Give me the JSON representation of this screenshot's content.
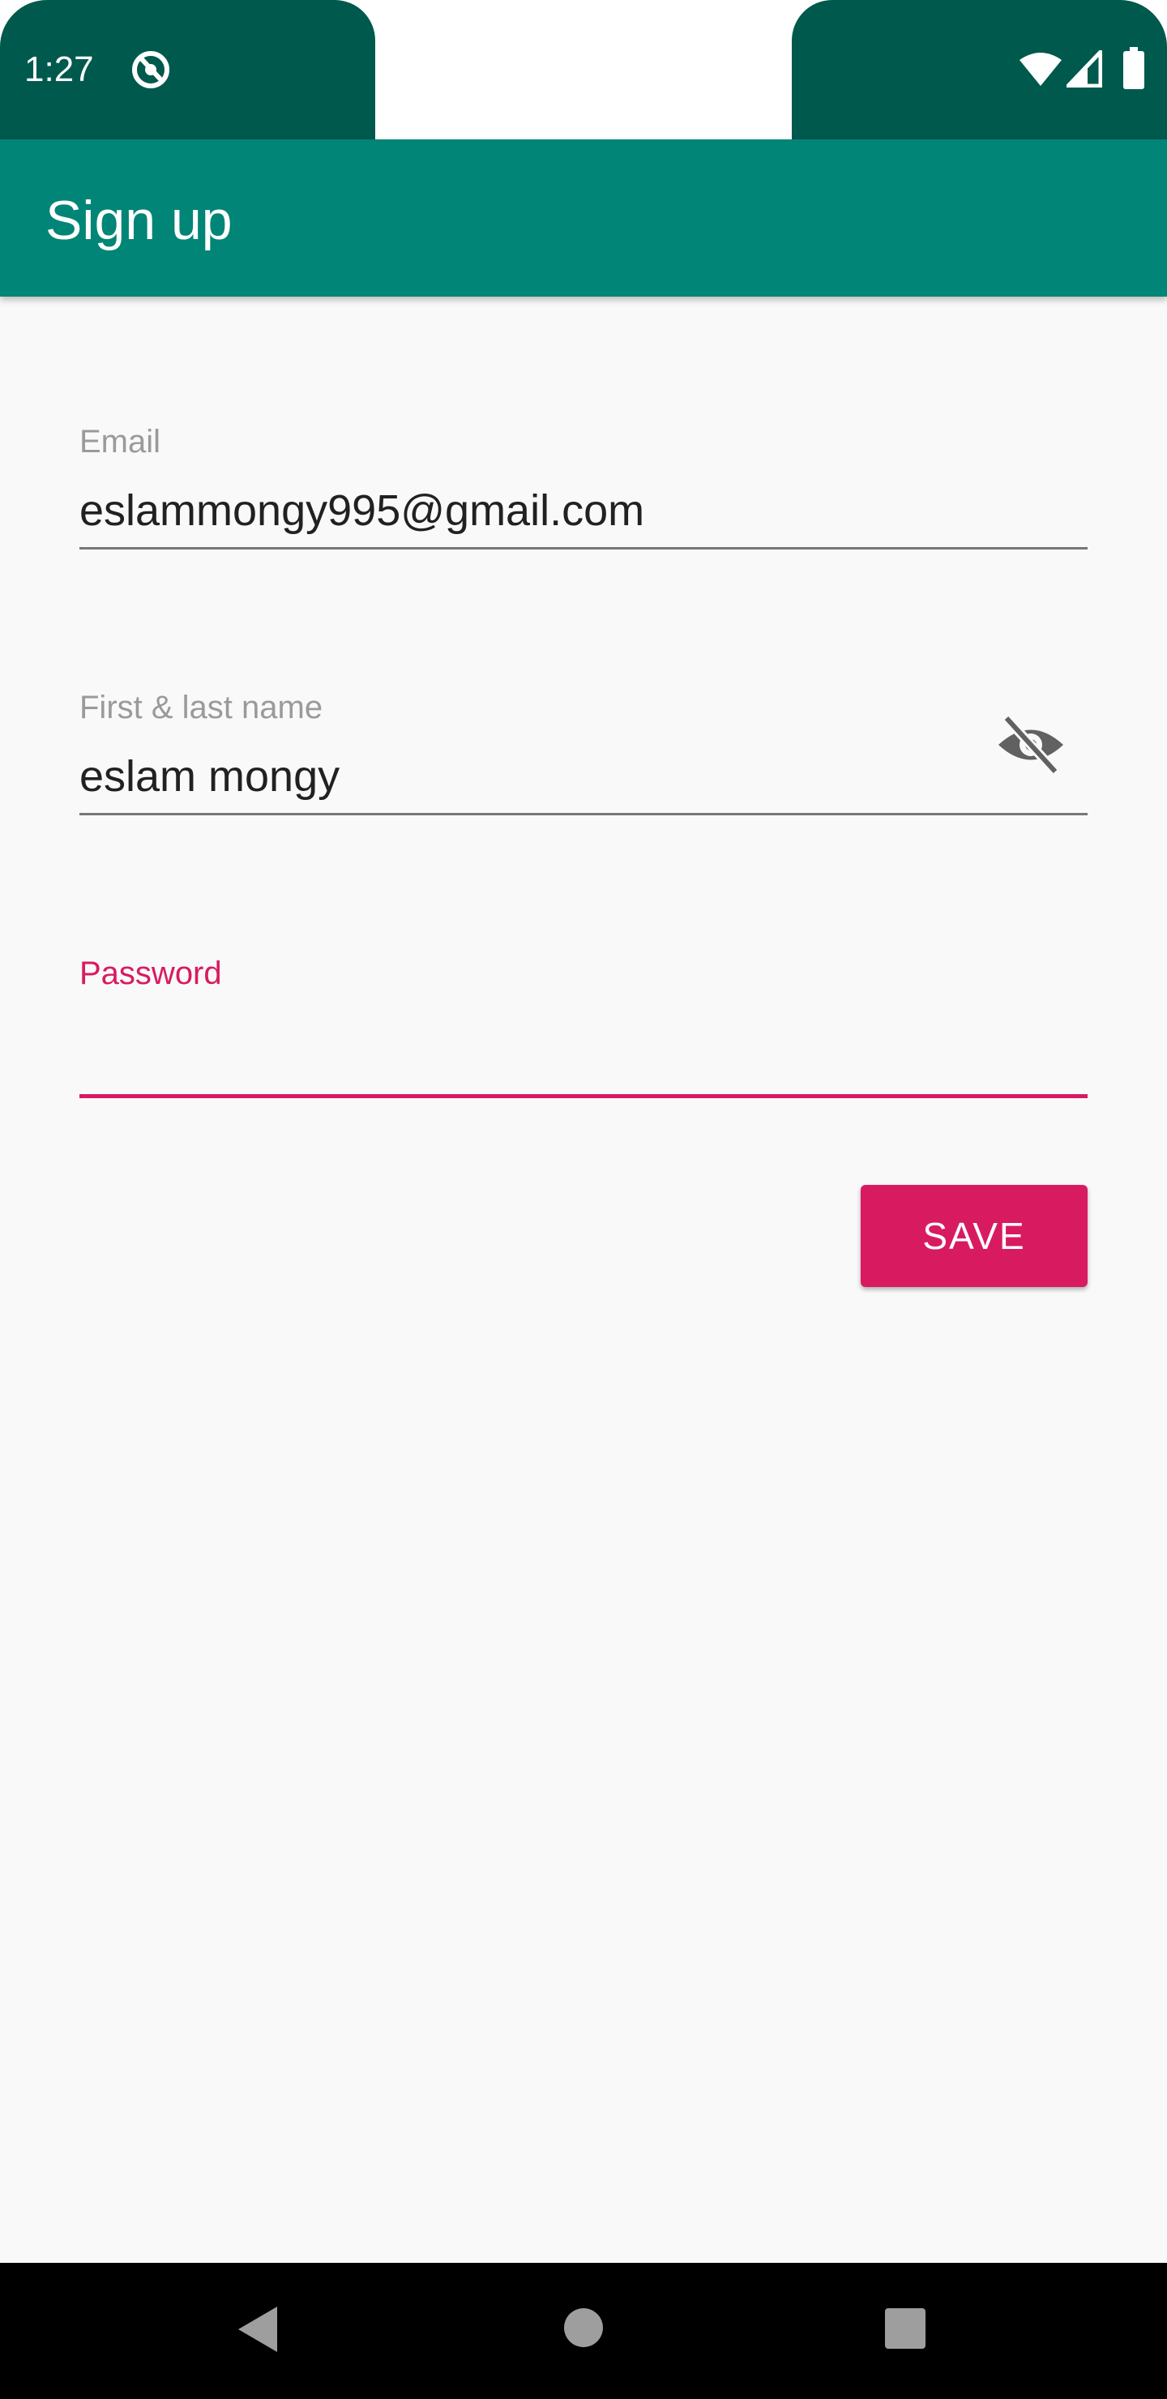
{
  "status_bar": {
    "time": "1:27",
    "icons": [
      "app-notification-icon",
      "wifi-icon",
      "cell-signal-icon",
      "battery-icon"
    ]
  },
  "app_bar": {
    "title": "Sign up"
  },
  "form": {
    "email": {
      "label": "Email",
      "value": "eslammongy995@gmail.com"
    },
    "name": {
      "label": "First & last name",
      "value": "eslam mongy"
    },
    "password": {
      "label": "Password",
      "value": "",
      "toggle_icon": "visibility-off-icon"
    },
    "save_label": "SAVE"
  },
  "nav_bar": {
    "icons": [
      "back-icon",
      "home-icon",
      "recents-icon"
    ]
  },
  "colors": {
    "status_bar": "#00594d",
    "app_bar": "#008577",
    "accent": "#d81b60",
    "background": "#f9f9f9"
  }
}
